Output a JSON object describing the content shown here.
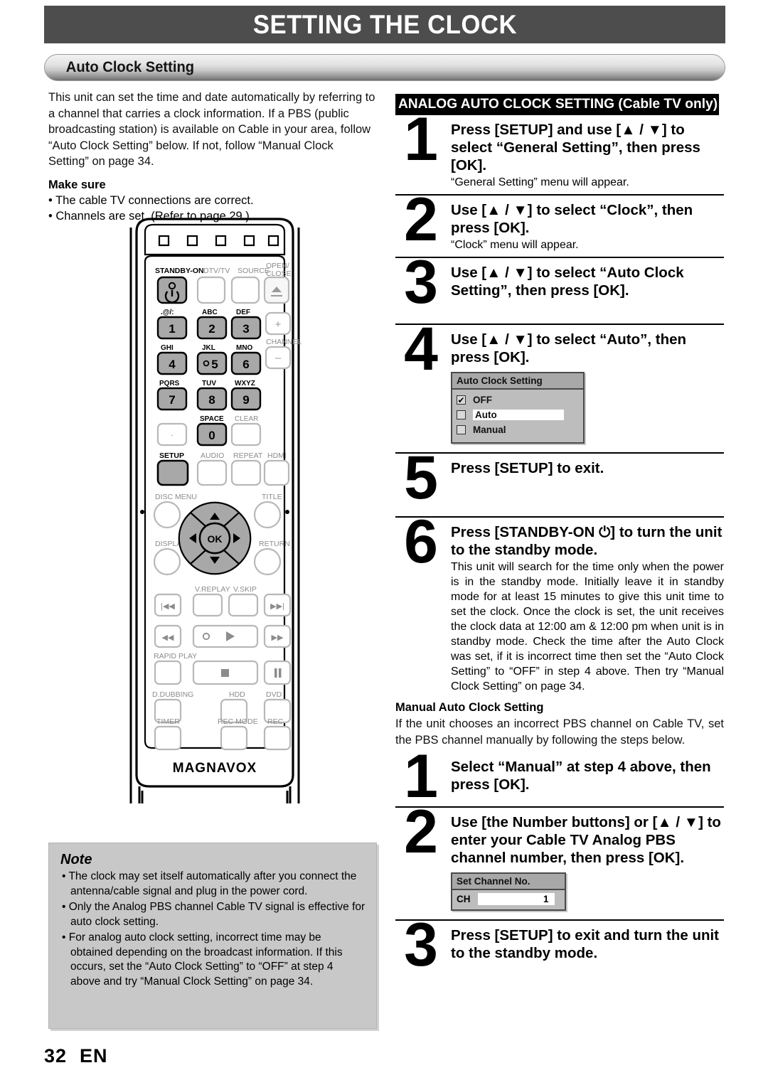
{
  "header": {
    "title": "SETTING THE CLOCK",
    "section_title": "Auto Clock Setting"
  },
  "left": {
    "intro": "This unit can set the time and date automatically by referring to a channel that carries a clock information. If a PBS (public broadcasting station) is available on Cable in your area, follow “Auto Clock Setting” below. If not, follow “Manual Clock Setting” on page 34.",
    "make_sure_title": "Make sure",
    "make_sure_items": [
      "• The cable TV connections are correct.",
      "• Channels are set. (Refer to page 29.)"
    ],
    "note": {
      "title": "Note",
      "items": [
        "• The clock may set itself automatically after you connect the antenna/cable signal and plug in the power cord.",
        "• Only the Analog PBS channel Cable TV signal is effective for auto clock setting.",
        "• For analog auto clock setting, incorrect time may be obtained depending on the broadcast information. If this occurs, set the “Auto Clock Setting” to “OFF” at step 4 above and try “Manual Clock Setting” on page 34."
      ]
    }
  },
  "remote": {
    "brand": "MAGNAVOX",
    "labels": {
      "standby_on": "STANDBY-ON",
      "dtv_tv": "DTV/TV",
      "source": "SOURCE",
      "open_close_1": "OPEN/",
      "open_close_2": "CLOSE",
      "key1_top": ".@/:",
      "key2_top": "ABC",
      "key3_top": "DEF",
      "key4_top": "GHI",
      "key5_top": "JKL",
      "key6_top": "MNO",
      "key7_top": "PQRS",
      "key8_top": "TUV",
      "key9_top": "WXYZ",
      "space": "SPACE",
      "clear": "CLEAR",
      "channel": "CHANNEL",
      "plus": "+",
      "minus": "−",
      "num1": "1",
      "num2": "2",
      "num3": "3",
      "num4": "4",
      "num5": "5",
      "num6": "6",
      "num7": "7",
      "num8": "8",
      "num9": "9",
      "num0": "0",
      "setup": "SETUP",
      "audio": "AUDIO",
      "repeat": "REPEAT",
      "hdmi": "HDMI",
      "disc_menu": "DISC MENU",
      "title": "TITLE",
      "display": "DISPLAY",
      "return": "RETURN",
      "ok": "OK",
      "v_replay": "V.REPLAY",
      "v_skip": "V.SKIP",
      "rapid_play": "RAPID PLAY",
      "d_dubbing": "D.DUBBING",
      "hdd": "HDD",
      "dvd": "DVD",
      "timer": "TIMER",
      "rec_mode": "REC MODE",
      "rec": "REC"
    }
  },
  "right": {
    "analog_heading": "ANALOG AUTO CLOCK SETTING (Cable TV only)",
    "steps": [
      {
        "num": "1",
        "head": "Press [SETUP] and use [▲ / ▼] to select “General Setting”, then press [OK].",
        "sub": "“General Setting” menu will appear."
      },
      {
        "num": "2",
        "head": "Use [▲ / ▼] to select “Clock”, then press [OK].",
        "sub": "“Clock” menu will appear."
      },
      {
        "num": "3",
        "head": "Use [▲ / ▼] to select “Auto Clock Setting”, then press [OK].",
        "sub": ""
      },
      {
        "num": "4",
        "head": "Use [▲ / ▼] to select “Auto”, then press [OK].",
        "sub": ""
      },
      {
        "num": "5",
        "head": "Press [SETUP] to exit.",
        "sub": ""
      },
      {
        "num": "6",
        "head": "Press [STANDBY-ON ⏻] to turn the unit to the standby mode.",
        "sub": "This unit will search for the time only when the power is in the standby mode. Initially leave it in standby mode for at least 15 minutes to give this unit time to set the clock. Once the clock is set, the unit receives the clock data at 12:00 am & 12:00 pm when unit is in standby mode. Check the time after the Auto Clock was set, if it is incorrect time then set the “Auto Clock Setting” to “OFF” in step 4 above. Then try “Manual Clock Setting” on page 34."
      }
    ],
    "auto_clock_osd": {
      "title": "Auto Clock Setting",
      "rows": [
        {
          "label": "OFF",
          "checked": true,
          "highlight": false
        },
        {
          "label": "Auto",
          "checked": false,
          "highlight": true
        },
        {
          "label": "Manual",
          "checked": false,
          "highlight": false
        }
      ]
    },
    "manual_section": {
      "title": "Manual Auto Clock Setting",
      "intro": "If the unit chooses an incorrect PBS channel on Cable TV, set the PBS channel manually by following the steps below.",
      "steps": [
        {
          "num": "1",
          "head": "Select “Manual” at step 4 above, then press [OK].",
          "sub": ""
        },
        {
          "num": "2",
          "head": "Use [the Number buttons] or [▲ / ▼] to enter your Cable TV Analog PBS channel number, then press [OK].",
          "sub": ""
        },
        {
          "num": "3",
          "head": "Press [SETUP] to exit and turn the unit to the standby mode.",
          "sub": ""
        }
      ],
      "set_channel_osd": {
        "title": "Set Channel No.",
        "ch_label": "CH",
        "ch_value": "1"
      }
    }
  },
  "footer": {
    "page_number": "32",
    "language": "EN"
  }
}
